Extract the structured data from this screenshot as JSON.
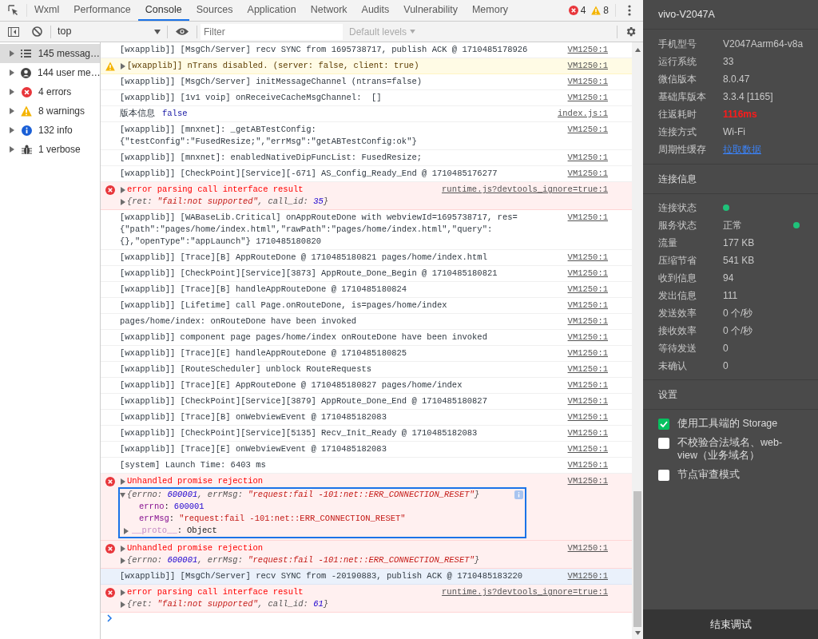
{
  "tabs": [
    {
      "label": "Wxml",
      "selected": false
    },
    {
      "label": "Performance",
      "selected": false
    },
    {
      "label": "Console",
      "selected": true
    },
    {
      "label": "Sources",
      "selected": false
    },
    {
      "label": "Application",
      "selected": false
    },
    {
      "label": "Network",
      "selected": false
    },
    {
      "label": "Audits",
      "selected": false
    },
    {
      "label": "Vulnerability",
      "selected": false
    },
    {
      "label": "Memory",
      "selected": false
    }
  ],
  "counts": {
    "errors": "4",
    "warnings": "8"
  },
  "toolbar": {
    "context": "top",
    "filter_placeholder": "Filter",
    "levels": "Default levels"
  },
  "filters": [
    {
      "kind": "messages",
      "label": "145 messag…",
      "selected": true
    },
    {
      "kind": "user",
      "label": "144 user me…",
      "selected": false
    },
    {
      "kind": "error",
      "label": "4 errors",
      "selected": false
    },
    {
      "kind": "warning",
      "label": "8 warnings",
      "selected": false
    },
    {
      "kind": "info",
      "label": "132 info",
      "selected": false
    },
    {
      "kind": "verbose",
      "label": "1 verbose",
      "selected": false
    }
  ],
  "rows": [
    {
      "kind": "log",
      "hovered": false,
      "message": "[wxapplib]] [MsgCh/Server] recv SYNC from 1695738717, publish ACK @ 1710485178926",
      "source": "VM1250:1"
    },
    {
      "kind": "warning",
      "hovered": false,
      "message": "[wxapplib]] nTrans disabled. (server: false, client: true)",
      "source": "VM1250:1"
    },
    {
      "kind": "log",
      "hovered": false,
      "message": "[wxapplib]] [MsgCh/Server] initMessageChannel (ntrans=false)",
      "source": "VM1250:1"
    },
    {
      "kind": "log",
      "hovered": false,
      "message": "[wxapplib]] [1v1 voip] onReceiveCacheMsgChannel:  []",
      "source": "VM1250:1"
    },
    {
      "kind": "log",
      "hovered": false,
      "message": "版本信息",
      "value": "false",
      "source": "index.js:1"
    },
    {
      "kind": "log",
      "hovered": false,
      "message": "[wxapplib]] [mnxnet]: _getABTestConfig: {\"testConfig\":\"FusedResize;\",\"errMsg\":\"getABTestConfig:ok\"}",
      "source": "VM1250:1"
    },
    {
      "kind": "log",
      "hovered": false,
      "message": "[wxapplib]] [mnxnet]: enabledNativeDipFuncList: FusedResize;",
      "source": "VM1250:1"
    },
    {
      "kind": "log",
      "hovered": false,
      "message": "[wxapplib]] [CheckPoint][Service][-671] AS_Config_Ready_End @ 1710485176277",
      "source": "VM1250:1"
    },
    {
      "kind": "error",
      "hovered": false,
      "message": "error parsing call interface result",
      "source": "runtime.js?devtools_ignore=true:1",
      "detail": {
        "expanded": false,
        "parts": [
          {
            "kind": "plain",
            "text": "{ret: "
          },
          {
            "kind": "string",
            "text": "\"fail:not supported\""
          },
          {
            "kind": "plain",
            "text": ", call_id: "
          },
          {
            "kind": "number",
            "text": "35"
          },
          {
            "kind": "plain",
            "text": "}"
          }
        ]
      }
    },
    {
      "kind": "log",
      "hovered": false,
      "message": "[wxapplib]] [WABaseLib.Critical] onAppRouteDone with webviewId=1695738717, res= {\"path\":\"pages/home/index.html\",\"rawPath\":\"pages/home/index.html\",\"query\": {},\"openType\":\"appLaunch\"} 1710485180820",
      "source": "VM1250:1"
    },
    {
      "kind": "log",
      "hovered": false,
      "message": "[wxapplib]] [Trace][B] AppRouteDone @ 1710485180821 pages/home/index.html",
      "source": "VM1250:1"
    },
    {
      "kind": "log",
      "hovered": false,
      "message": "[wxapplib]] [CheckPoint][Service][3873] AppRoute_Done_Begin @ 1710485180821",
      "source": "VM1250:1"
    },
    {
      "kind": "log",
      "hovered": false,
      "message": "[wxapplib]] [Trace][B] handleAppRouteDone @ 1710485180824",
      "source": "VM1250:1"
    },
    {
      "kind": "log",
      "hovered": false,
      "message": "[wxapplib]] [Lifetime] call Page.onRouteDone, is=pages/home/index",
      "source": "VM1250:1"
    },
    {
      "kind": "log",
      "hovered": false,
      "message": "pages/home/index: onRouteDone have been invoked",
      "source": "VM1250:1"
    },
    {
      "kind": "log",
      "hovered": false,
      "message": "[wxapplib]] component page pages/home/index onRouteDone have been invoked",
      "source": "VM1250:1"
    },
    {
      "kind": "log",
      "hovered": false,
      "message": "[wxapplib]] [Trace][E] handleAppRouteDone @ 1710485180825",
      "source": "VM1250:1"
    },
    {
      "kind": "log",
      "hovered": false,
      "message": "[wxapplib]] [RouteScheduler] unblock RouteRequests",
      "source": "VM1250:1"
    },
    {
      "kind": "log",
      "hovered": false,
      "message": "[wxapplib]] [Trace][E] AppRouteDone @ 1710485180827 pages/home/index",
      "source": "VM1250:1"
    },
    {
      "kind": "log",
      "hovered": false,
      "message": "[wxapplib]] [CheckPoint][Service][3879] AppRoute_Done_End @ 1710485180827",
      "source": "VM1250:1"
    },
    {
      "kind": "log",
      "hovered": false,
      "message": "[wxapplib]] [Trace][B] onWebviewEvent @ 1710485182083",
      "source": "VM1250:1"
    },
    {
      "kind": "log",
      "hovered": false,
      "message": "[wxapplib]] [CheckPoint][Service][5135] Recv_Init_Ready @ 1710485182083",
      "source": "VM1250:1"
    },
    {
      "kind": "log",
      "hovered": false,
      "message": "[wxapplib]] [Trace][E] onWebviewEvent @ 1710485182083",
      "source": "VM1250:1"
    },
    {
      "kind": "log",
      "hovered": false,
      "message": "[system] Launch Time: 6403 ms",
      "source": "VM1250:1"
    },
    {
      "kind": "error",
      "hovered": false,
      "message": "Unhandled promise rejection",
      "source": "VM1250:1",
      "detail": {
        "expanded": true,
        "parts": [
          {
            "kind": "plain",
            "text": "{errno: "
          },
          {
            "kind": "number",
            "text": "600001"
          },
          {
            "kind": "plain",
            "text": ", errMsg: "
          },
          {
            "kind": "string",
            "text": "\"request:fail -101:net::ERR_CONNECTION_RESET\""
          },
          {
            "kind": "plain",
            "text": "}"
          }
        ],
        "properties": [
          {
            "kind": "number",
            "key": "errno",
            "separator": ":",
            "value": "600001"
          },
          {
            "kind": "string",
            "key": "errMsg",
            "separator": ":",
            "value": "\"request:fail -101:net::ERR_CONNECTION_RESET\""
          },
          {
            "kind": "proto",
            "key": "__proto__",
            "separator": ":",
            "value": "Object"
          }
        ]
      }
    },
    {
      "kind": "error",
      "hovered": false,
      "message": "Unhandled promise rejection",
      "source": "VM1250:1",
      "detail": {
        "expanded": false,
        "parts": [
          {
            "kind": "plain",
            "text": "{errno: "
          },
          {
            "kind": "number",
            "text": "600001"
          },
          {
            "kind": "plain",
            "text": ", errMsg: "
          },
          {
            "kind": "string",
            "text": "\"request:fail -101:net::ERR_CONNECTION_RESET\""
          },
          {
            "kind": "plain",
            "text": "}"
          }
        ]
      }
    },
    {
      "kind": "log",
      "hovered": true,
      "message": "[wxapplib]] [MsgCh/Server] recv SYNC from -20190883, publish ACK @ 1710485183220",
      "source": "VM1250:1"
    },
    {
      "kind": "error",
      "hovered": false,
      "message": "error parsing call interface result",
      "source": "runtime.js?devtools_ignore=true:1",
      "detail": {
        "expanded": false,
        "parts": [
          {
            "kind": "plain",
            "text": "{ret: "
          },
          {
            "kind": "string",
            "text": "\"fail:not supported\""
          },
          {
            "kind": "plain",
            "text": ", call_id: "
          },
          {
            "kind": "number",
            "text": "61"
          },
          {
            "kind": "plain",
            "text": "}"
          }
        ]
      }
    }
  ],
  "panel": {
    "device": "vivo-V2047A",
    "info": [
      {
        "label": "手机型号",
        "value": "V2047Aarm64-v8a",
        "kind": "text"
      },
      {
        "label": "运行系统",
        "value": "33",
        "kind": "text"
      },
      {
        "label": "微信版本",
        "value": "8.0.47",
        "kind": "text"
      },
      {
        "label": "基础库版本",
        "value": "3.3.4 [1165]",
        "kind": "text"
      },
      {
        "label": "往返耗时",
        "value": "1116ms",
        "kind": "alert"
      },
      {
        "label": "连接方式",
        "value": "Wi-Fi",
        "kind": "text"
      },
      {
        "label": "周期性缓存",
        "value": "拉取数据",
        "kind": "link"
      }
    ],
    "connection_title": "连接信息",
    "connection": [
      {
        "label": "连接状态",
        "color": "#1fc27a"
      },
      {
        "label": "服务状态",
        "value": "正常",
        "color": "#1fc27a"
      },
      {
        "label": "流量",
        "value": "177 KB"
      },
      {
        "label": "压缩节省",
        "value": "541 KB"
      },
      {
        "label": "收到信息",
        "value": "94"
      },
      {
        "label": "发出信息",
        "value": "111"
      },
      {
        "label": "发送效率",
        "value": "0 个/秒"
      },
      {
        "label": "接收效率",
        "value": "0 个/秒"
      },
      {
        "label": "等待发送",
        "value": "0"
      },
      {
        "label": "未确认",
        "value": "0"
      }
    ],
    "settings_title": "设置",
    "settings": [
      {
        "label": "使用工具端的 Storage",
        "checked": true
      },
      {
        "label": "不校验合法域名、web-view（业务域名）",
        "checked": false
      },
      {
        "label": "节点审查模式",
        "checked": false
      }
    ],
    "end_button": "结束调试"
  }
}
